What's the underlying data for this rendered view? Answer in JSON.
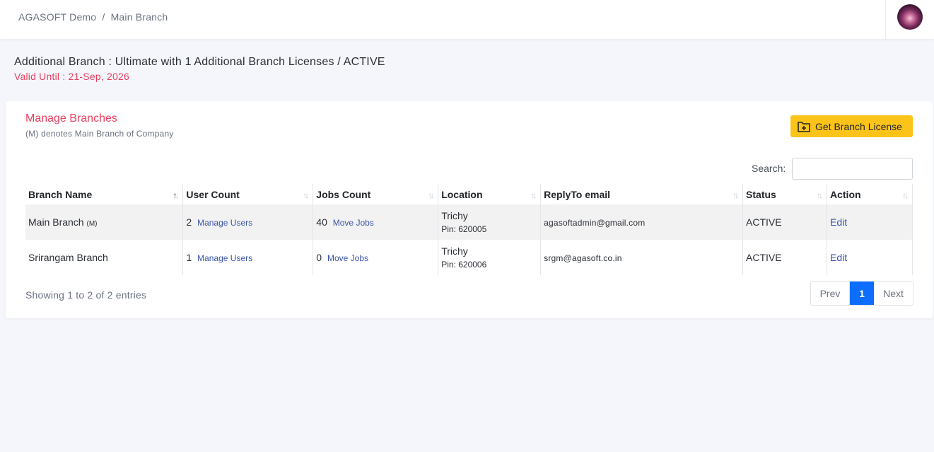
{
  "header": {
    "breadcrumb_company": "AGASOFT Demo",
    "breadcrumb_separator": "/",
    "breadcrumb_branch": "Main Branch",
    "avatar_icon": "user-avatar-icon"
  },
  "license": {
    "title": "Additional Branch : Ultimate with 1 Additional Branch Licenses / ACTIVE",
    "valid_until": "Valid Until : 21-Sep, 2026"
  },
  "card": {
    "title": "Manage Branches",
    "subtitle": "(M) denotes Main Branch of Company",
    "button_label": "Get Branch License",
    "button_icon": "folder-plus-icon",
    "button_color": "#fcc419"
  },
  "search": {
    "label": "Search:",
    "value": ""
  },
  "table": {
    "columns": [
      "Branch Name",
      "User Count",
      "Jobs Count",
      "Location",
      "ReplyTo email",
      "Status",
      "Action"
    ],
    "sorted_column": "Branch Name",
    "rows": [
      {
        "branch_name": "Main Branch",
        "main_tag": "(M)",
        "user_count": "2",
        "user_link": "Manage Users",
        "jobs_count": "40",
        "jobs_link": "Move Jobs",
        "city": "Trichy",
        "pin": "Pin: 620005",
        "email": "agasoftadmin@gmail.com",
        "status": "ACTIVE",
        "action": "Edit"
      },
      {
        "branch_name": "Srirangam Branch",
        "main_tag": "",
        "user_count": "1",
        "user_link": "Manage Users",
        "jobs_count": "0",
        "jobs_link": "Move Jobs",
        "city": "Trichy",
        "pin": "Pin: 620006",
        "email": "srgm@agasoft.co.in",
        "status": "ACTIVE",
        "action": "Edit"
      }
    ]
  },
  "footer": {
    "info": "Showing 1 to 2 of 2 entries",
    "prev": "Prev",
    "page": "1",
    "next": "Next"
  },
  "colors": {
    "accent_red": "#e8405f",
    "link_blue": "#3a55a8",
    "active_page": "#0d6efd"
  }
}
